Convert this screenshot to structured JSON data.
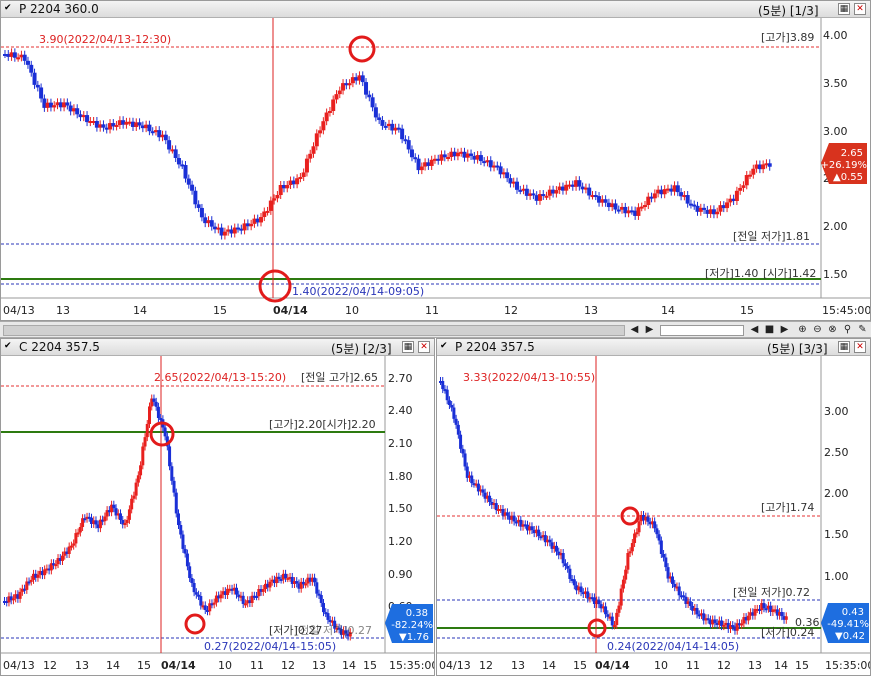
{
  "top": {
    "title": "P 2204 360.0",
    "meta": "(5분) [1/3]",
    "annotations": {
      "high_marker": "3.90(2022/04/13-12:30)",
      "low_marker": "1.40(2022/04/14-09:05)",
      "goga": "[고가]3.89",
      "prev_low": "[전일 저가]1.81",
      "low_open": "[저가]1.40",
      "siga": "[시가]1.42"
    },
    "badge": {
      "price": "2.65",
      "pct": "+26.19%",
      "chg": "▲0.55"
    },
    "y_ticks": [
      "4.00",
      "3.50",
      "3.00",
      "2.50",
      "2.00",
      "1.50"
    ],
    "x_ticks": [
      "04/13",
      "13",
      "14",
      "15",
      "04/14",
      "10",
      "11",
      "12",
      "13",
      "14",
      "15",
      "15:45:00"
    ]
  },
  "midleft": {
    "title": "C 2204 357.5",
    "meta": "(5분) [2/3]",
    "annotations": {
      "high_marker": "2.65(2022/04/13-15:20)",
      "prev_high": "[전일 고가]2.65",
      "goga_siga": "[고가]2.20[시가]2.20",
      "low_label": "[저가]0.27",
      "prev_low_overlap": "[전일 저가]0.27",
      "low_marker": "0.27(2022/04/14-15:05)"
    },
    "badge": {
      "price": "0.38",
      "pct": "-82.24%",
      "chg": "▼1.76"
    },
    "y_ticks": [
      "2.70",
      "2.40",
      "2.10",
      "1.80",
      "1.50",
      "1.20",
      "0.90",
      "0.60"
    ],
    "x_ticks": [
      "04/13",
      "12",
      "13",
      "14",
      "15",
      "04/14",
      "10",
      "11",
      "12",
      "13",
      "14",
      "15",
      "15:35:00"
    ]
  },
  "midright": {
    "title": "P 2204 357.5",
    "meta": "(5분) [3/3]",
    "annotations": {
      "high_marker": "3.33(2022/04/13-10:55)",
      "goga": "[고가]1.74",
      "prev_low": "[전일 저가]0.72",
      "low_marker": "0.24(2022/04/14-14:05)",
      "low_label": "[저가]0.24",
      "siga": "0.36"
    },
    "badge": {
      "price": "0.43",
      "pct": "-49.41%",
      "chg": "▼0.42"
    },
    "y_ticks": [
      "3.00",
      "2.50",
      "2.00",
      "1.50",
      "1.00"
    ],
    "x_ticks": [
      "04/13",
      "12",
      "13",
      "14",
      "15",
      "04/14",
      "10",
      "11",
      "12",
      "13",
      "14",
      "15",
      "15:35:00"
    ]
  },
  "colors": {
    "up": "#e8201e",
    "down": "#1a2fd6",
    "badge_up": "#d8331e",
    "badge_down": "#1e6ee0",
    "guide_green": "#2d7a10",
    "marker_red": "#e21b1b"
  }
}
